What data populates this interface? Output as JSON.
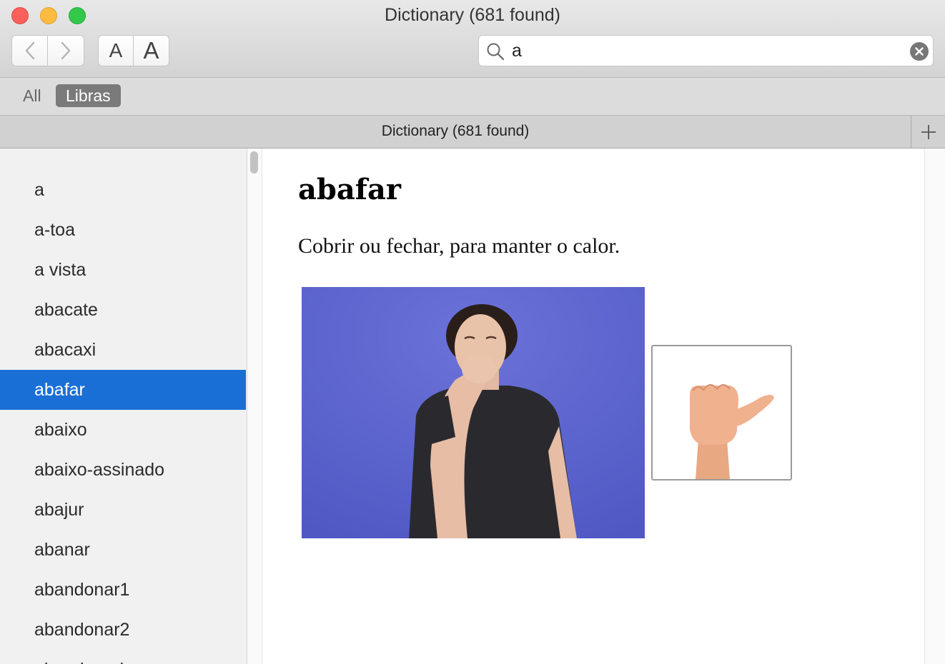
{
  "window": {
    "title": "Dictionary (681 found)"
  },
  "toolbar": {
    "back_icon": "chevron-left-icon",
    "forward_icon": "chevron-right-icon",
    "font_smaller_label": "A",
    "font_larger_label": "A"
  },
  "search": {
    "value": "a",
    "icon": "search-icon",
    "clear_icon": "clear-icon"
  },
  "scope_bar": {
    "items": [
      {
        "label": "All",
        "active": false
      },
      {
        "label": "Libras",
        "active": true
      }
    ]
  },
  "tab": {
    "title": "Dictionary (681 found)",
    "add_icon": "plus-icon"
  },
  "sidebar": {
    "items": [
      {
        "label": "a"
      },
      {
        "label": "a-toa"
      },
      {
        "label": "a vista"
      },
      {
        "label": "abacate"
      },
      {
        "label": "abacaxi"
      },
      {
        "label": "abafar",
        "selected": true
      },
      {
        "label": "abaixo"
      },
      {
        "label": "abaixo-assinado"
      },
      {
        "label": "abajur"
      },
      {
        "label": "abanar"
      },
      {
        "label": "abandonar1"
      },
      {
        "label": "abandonar2"
      },
      {
        "label": "abandonado"
      }
    ]
  },
  "entry": {
    "word": "abafar",
    "definition": "Cobrir ou fechar, para manter o calor."
  },
  "colors": {
    "selection": "#1a6fd6",
    "video_background": "#5b63cf",
    "scope_active": "#7a7a7a"
  }
}
